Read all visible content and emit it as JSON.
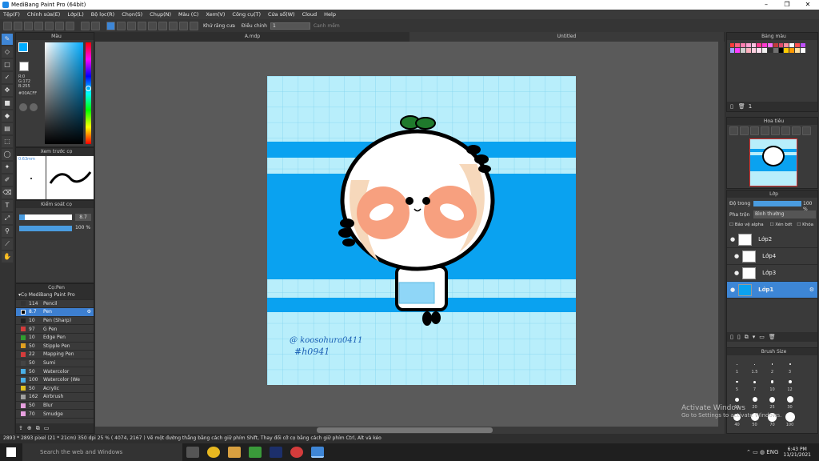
{
  "window": {
    "title": "MediBang Paint Pro (64bit)",
    "minimize": "–",
    "restore": "❐",
    "close": "✕"
  },
  "menu": [
    "Tệp(F)",
    "Chỉnh sửa(E)",
    "Lớp(L)",
    "Bộ lọc(R)",
    "Chọn(S)",
    "Chụp(N)",
    "Màu (C)",
    "Xem(V)",
    "Công cụ(T)",
    "Cửa sổ(W)",
    "Cloud",
    "Help"
  ],
  "toolbar": {
    "antialias": "Khử răng cưa",
    "adjust_label": "Điều chỉnh",
    "adjust_value": "1",
    "snap": "Canh mềm"
  },
  "tabs": [
    "A.mdp",
    "Untitled"
  ],
  "panels": {
    "color": {
      "title": "Màu",
      "r": "R:0",
      "g": "G:172",
      "b": "B:255",
      "hex": "#00ACFF",
      "accent": "#00ACFF"
    },
    "brush_preview": {
      "title": "Xem trước cọ",
      "size": "0.63mm"
    },
    "brush_control": {
      "title": "Kiểm soát cọ",
      "size_value": "8.7",
      "opacity_value": "100 %"
    },
    "brush_list": {
      "title": "Cọ:Pen",
      "group": "Cọ MediBang Paint Pro",
      "items": [
        {
          "size": "114",
          "name": "Pencil",
          "color": "#333333"
        },
        {
          "size": "8.7",
          "name": "Pen",
          "color": "#000000"
        },
        {
          "size": "10",
          "name": "Pen (Sharp)",
          "color": "#222222"
        },
        {
          "size": "97",
          "name": "G Pen",
          "color": "#d43c3c"
        },
        {
          "size": "10",
          "name": "Edge Pen",
          "color": "#2f9e2f"
        },
        {
          "size": "50",
          "name": "Stipple Pen",
          "color": "#e0a020"
        },
        {
          "size": "22",
          "name": "Mapping Pen",
          "color": "#d43c3c"
        },
        {
          "size": "50",
          "name": "Sumi",
          "color": "#444444"
        },
        {
          "size": "50",
          "name": "Watercolor",
          "color": "#4ab0e8"
        },
        {
          "size": "100",
          "name": "Watercolor (We",
          "color": "#4ab0e8"
        },
        {
          "size": "50",
          "name": "Acrylic",
          "color": "#e0c020"
        },
        {
          "size": "162",
          "name": "Airbrush",
          "color": "#a0a0a0"
        },
        {
          "size": "50",
          "name": "Blur",
          "color": "#e8a0e0"
        },
        {
          "size": "70",
          "name": "Smudge",
          "color": "#e8a0e0"
        }
      ]
    },
    "palette": {
      "title": "Bảng màu",
      "count": "1"
    },
    "navigator": {
      "title": "Hoa tiêu"
    },
    "layers": {
      "title": "Lớp",
      "opacity_label": "Độ trong",
      "opacity_value": "100 %",
      "blend_label": "Pha trộn",
      "blend_value": "Bình thường",
      "protect_alpha": "Bảo vệ alpha",
      "clip": "Xén bớt",
      "lock": "Khóa",
      "items": [
        "Lớp2",
        "Lớp4",
        "Lớp3",
        "Lớp1"
      ]
    },
    "brush_size": {
      "title": "Brush Size",
      "sizes": [
        "1",
        "1.5",
        "2",
        "3",
        "5",
        "7",
        "10",
        "12",
        "15",
        "20",
        "25",
        "30",
        "40",
        "50",
        "70",
        "100"
      ]
    }
  },
  "canvas": {
    "signature_line1": "@ koosohura0411",
    "signature_line2": "#h0941",
    "bg": "#b8eefb",
    "stripe": "#0aa2f0"
  },
  "status": {
    "text": "2893 * 2893 pixel   (21 * 21cm)   350 dpi   25 %   ( 4074, 2167 )   Vẽ một đường thẳng bằng cách giữ phím Shift, Thay đổi cỡ cọ bằng cách giữ phím Ctrl, Alt và kéo"
  },
  "watermark": {
    "line1": "Activate Windows",
    "line2": "Go to Settings to activate Windows."
  },
  "taskbar": {
    "search": "Search the web and Windows",
    "time": "6:43 PM",
    "date": "11/21/2021"
  }
}
